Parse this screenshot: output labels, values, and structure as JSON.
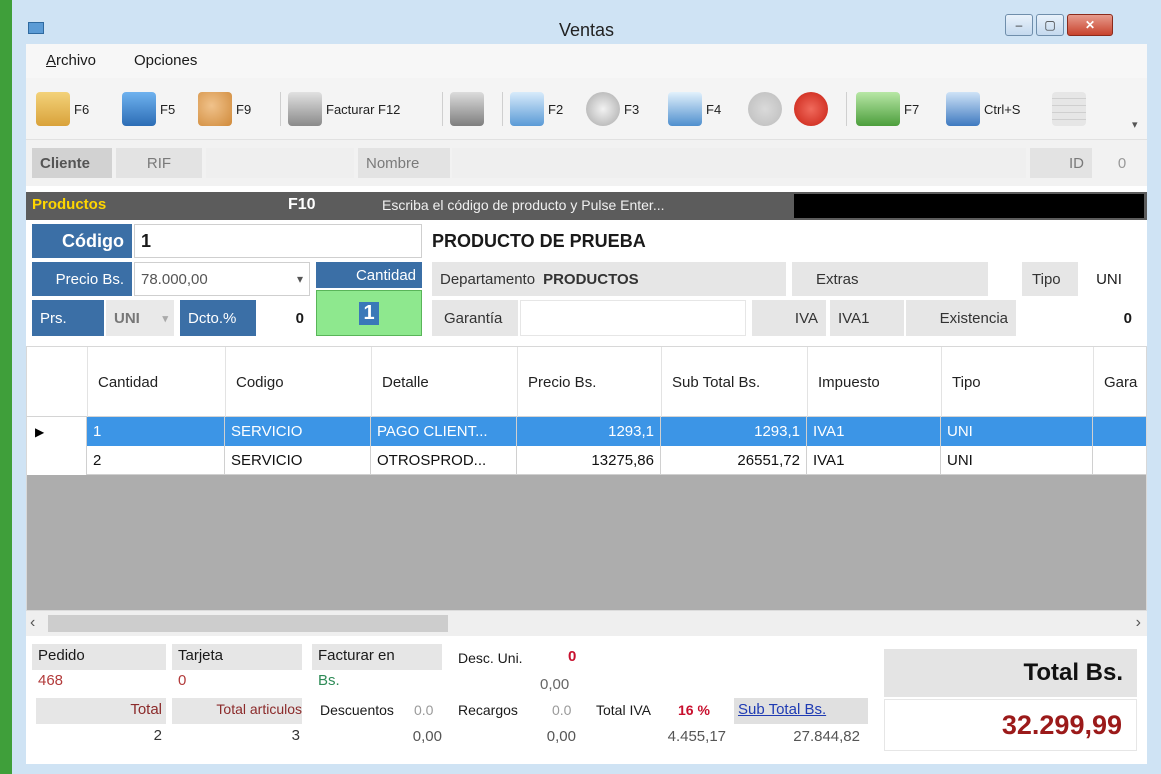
{
  "window": {
    "title": "Ventas"
  },
  "menu": {
    "archivo_rest": "rchivo",
    "archivo_first": "A",
    "opciones": "Opciones"
  },
  "toolbar": [
    {
      "icon": "open-folder-icon",
      "label": "F6"
    },
    {
      "icon": "save-disk-icon",
      "label": "F5"
    },
    {
      "icon": "add-users-icon",
      "label": "F9"
    },
    {
      "icon": "printer-icon",
      "label": "Facturar F12"
    },
    {
      "icon": "printer-small-icon",
      "label": ""
    },
    {
      "icon": "window-icon",
      "label": "F2"
    },
    {
      "icon": "refresh-icon",
      "label": "F3"
    },
    {
      "icon": "search-magnifier-icon",
      "label": "F4"
    },
    {
      "icon": "minus-disabled-icon",
      "label": ""
    },
    {
      "icon": "remove-red-icon",
      "label": ""
    },
    {
      "icon": "money-icon",
      "label": "F7"
    },
    {
      "icon": "spellcheck-icon",
      "label": "Ctrl+S"
    },
    {
      "icon": "grid-icon",
      "label": ""
    }
  ],
  "client": {
    "label": "Cliente",
    "rif": "RIF",
    "nombre": "Nombre",
    "id_label": "ID",
    "id_value": "0"
  },
  "products": {
    "title": "Productos",
    "shortcut": "F10",
    "hint": "Escriba el código de producto y Pulse Enter...",
    "codigo_label": "Código",
    "codigo_value": "1",
    "product_name": "PRODUCTO DE PRUEBA",
    "precio_label": "Precio Bs.",
    "precio_value": "78.000,00",
    "cantidad_label": "Cantidad",
    "cantidad_value": "1",
    "departamento_label": "Departamento",
    "departamento_value": "PRODUCTOS",
    "extras_label": "Extras",
    "tipo_label": "Tipo",
    "tipo_value": "UNI",
    "prs_label": "Prs.",
    "prs_value": "UNI",
    "dcto_label": "Dcto.%",
    "dcto_value": "0",
    "garantia_label": "Garantía",
    "iva_label": "IVA",
    "iva_value": "IVA1",
    "existencia_label": "Existencia",
    "existencia_value": "0"
  },
  "grid": {
    "headers": [
      "Cantidad",
      "Codigo",
      "Detalle",
      "Precio Bs.",
      "Sub Total Bs.",
      "Impuesto",
      "Tipo",
      "Gara"
    ],
    "rows": [
      {
        "cantidad": "1",
        "codigo": "SERVICIO",
        "detalle": "PAGO CLIENT...",
        "precio": "1293,1",
        "subtotal": "1293,1",
        "impuesto": "IVA1",
        "tipo": "UNI"
      },
      {
        "cantidad": "2",
        "codigo": "SERVICIO",
        "detalle": "OTROSPROD...",
        "precio": "13275,86",
        "subtotal": "26551,72",
        "impuesto": "IVA1",
        "tipo": "UNI"
      }
    ]
  },
  "footer": {
    "pedido_label": "Pedido",
    "pedido_value": "468",
    "tarjeta_label": "Tarjeta",
    "tarjeta_value": "0",
    "facturar_label": "Facturar en",
    "facturar_value": "Bs.",
    "desc_uni_label": "Desc. Uni.",
    "desc_uni_value": "0",
    "desc_uni_amount": "0,00",
    "total_label": "Total",
    "total_value": "2",
    "total_articulos_label": "Total articulos",
    "total_articulos_value": "3",
    "descuentos_label": "Descuentos",
    "descuentos_pct": "0.0",
    "descuentos_value": "0,00",
    "recargos_label": "Recargos",
    "recargos_pct": "0.0",
    "recargos_value": "0,00",
    "total_iva_label": "Total IVA",
    "total_iva_pct": "16 %",
    "total_iva_value": "4.455,17",
    "subtotal_label": "Sub Total Bs.",
    "subtotal_value": "27.844,82",
    "total_bs_label": "Total Bs.",
    "total_bs_value": "32.299,99"
  }
}
